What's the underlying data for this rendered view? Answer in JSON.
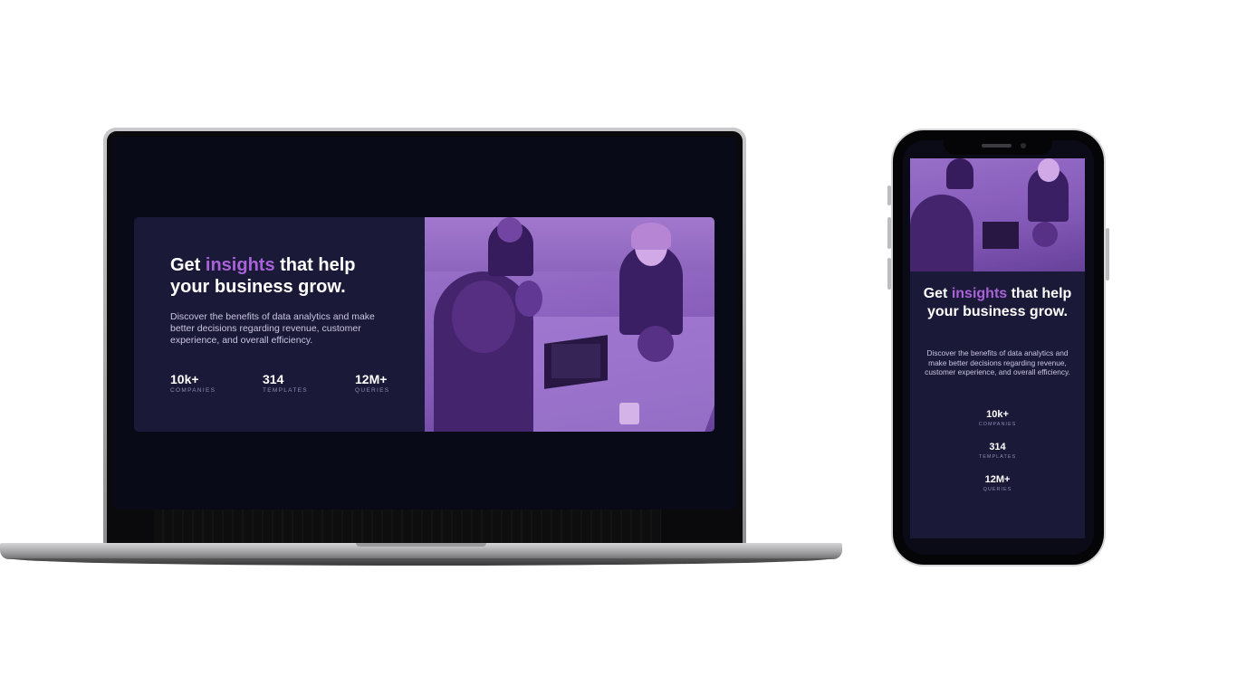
{
  "hero": {
    "headline_prefix": "Get ",
    "headline_accent": "insights",
    "headline_suffix": " that help your business grow.",
    "description": "Discover the benefits of data analytics and make better decisions regarding revenue, customer experience, and overall efficiency.",
    "stats": [
      {
        "value": "10k+",
        "label": "COMPANIES"
      },
      {
        "value": "314",
        "label": "TEMPLATES"
      },
      {
        "value": "12M+",
        "label": "QUERIES"
      }
    ]
  },
  "colors": {
    "page_background": "#080a18",
    "card_background": "#1b1938",
    "accent": "#a963d8",
    "image_overlay": "#aa5cdb"
  },
  "image": {
    "subject": "office-meeting-photo"
  }
}
